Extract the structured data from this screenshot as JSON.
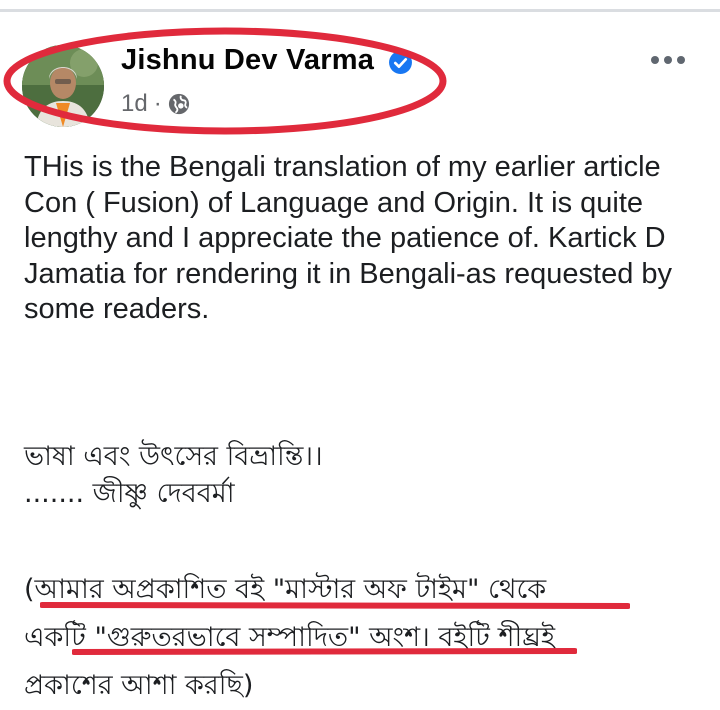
{
  "post": {
    "author": "Jishnu Dev Varma",
    "time": "1d",
    "separator": "·",
    "privacy_icon": "globe-icon",
    "verified_icon": "verified-badge-icon",
    "more_icon": "more-dots-icon",
    "body_english": "THis is the Bengali translation of my earlier article Con ( Fusion) of Language and Origin. It is quite lengthy and I appreciate the patience of. Kartick D Jamatia for rendering it in Bengali-as requested by some readers.",
    "bengali_title": "ভাষা এবং উৎসের বিভ্রান্তি।।",
    "bengali_byline": " ....... জীষ্ণু দেববর্মা",
    "bengali_note_line1": "(আমার অপ্রকাশিত বই \"মাস্টার অফ টাইম\" থেকে",
    "bengali_note_line2": "একটি \"গুরুতরভাবে সম্পাদিত\" অংশ। বইটি শীঘ্রই",
    "bengali_note_line3": "প্রকাশের আশা করছি)"
  },
  "colors": {
    "annotation_red": "#e02a3c",
    "verified_blue": "#1877f2",
    "meta_gray": "#65676b"
  }
}
